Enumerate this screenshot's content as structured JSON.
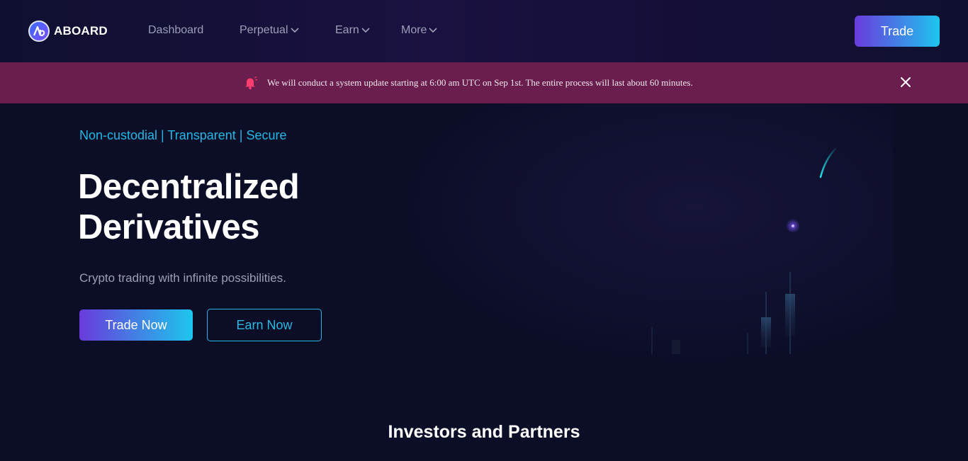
{
  "brand": {
    "name": "ABOARD"
  },
  "nav": {
    "items": [
      {
        "label": "Dashboard",
        "dropdown": false
      },
      {
        "label": "Perpetual",
        "dropdown": true
      },
      {
        "label": "Earn",
        "dropdown": true
      },
      {
        "label": "More",
        "dropdown": true
      }
    ],
    "trade_label": "Trade"
  },
  "banner": {
    "icon": "bell-icon",
    "message": "We will conduct a system update starting at 6:00 am UTC on Sep 1st. The entire process will last about 60 minutes.",
    "close_icon": "close-icon",
    "color": "#6a1e4e"
  },
  "hero": {
    "tagline": "Non-custodial | Transparent | Secure",
    "headline_line1": "Decentralized",
    "headline_line2": "Derivatives",
    "subtitle": "Crypto trading with infinite possibilities.",
    "primary_button": "Trade Now",
    "secondary_button": "Earn Now"
  },
  "sections": {
    "partners_title": "Investors and Partners"
  },
  "colors": {
    "background": "#0c0e28",
    "accent_cyan": "#21b8e6",
    "accent_purple": "#6a3bdc"
  }
}
